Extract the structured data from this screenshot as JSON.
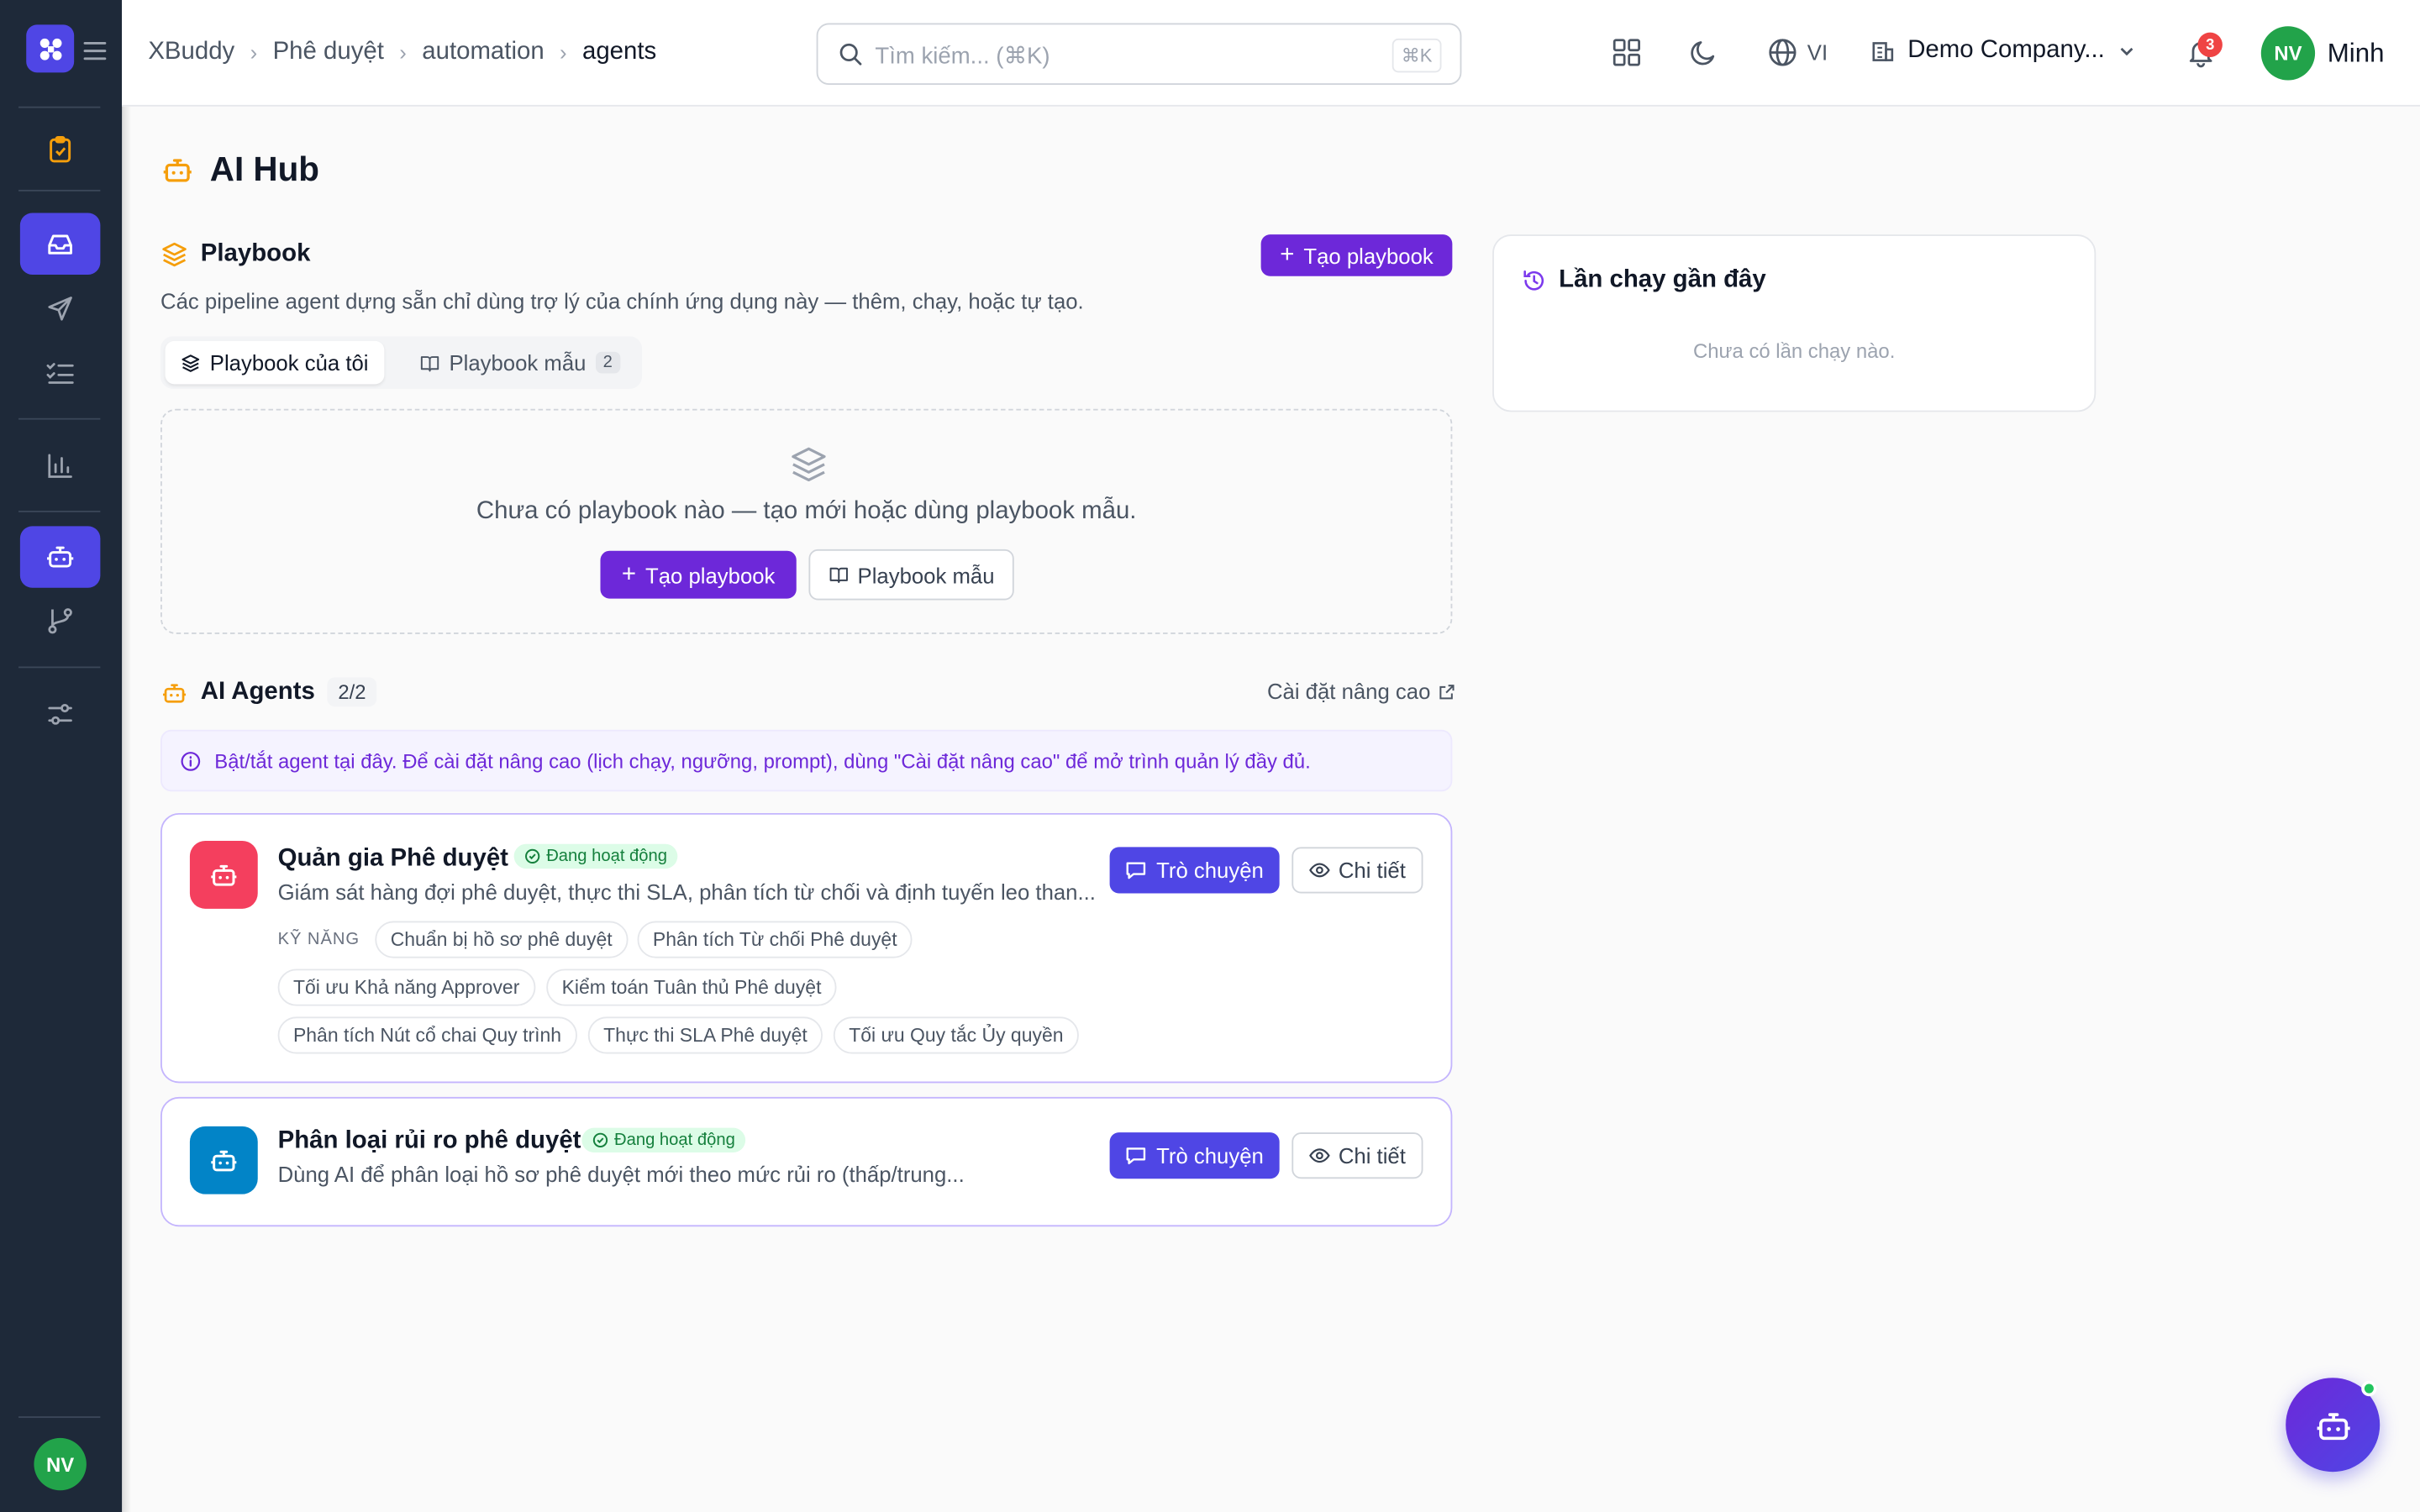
{
  "app": {
    "name": "XBuddy",
    "user_initials": "NV",
    "user_name": "Minh"
  },
  "breadcrumb": [
    "XBuddy",
    "Phê duyệt",
    "automation",
    "agents"
  ],
  "search": {
    "placeholder": "Tìm kiếm... (⌘K)",
    "shortcut": "⌘K"
  },
  "header": {
    "language": "VI",
    "company": "Demo Company...",
    "notification_count": "3"
  },
  "sidebar": {
    "icons": [
      "clipboard-check-icon",
      "inbox-icon",
      "send-icon",
      "list-checks-icon",
      "bar-chart-icon",
      "bot-icon",
      "git-branch-icon",
      "sliders-icon"
    ],
    "active": [
      "inbox-icon",
      "bot-icon"
    ]
  },
  "page": {
    "title": "AI Hub"
  },
  "playbook": {
    "title": "Playbook",
    "create_label": "Tạo playbook",
    "description": "Các pipeline agent dựng sẵn chỉ dùng trợ lý của chính ứng dụng này — thêm, chạy, hoặc tự tạo.",
    "tabs": [
      {
        "label": "Playbook của tôi",
        "active": true
      },
      {
        "label": "Playbook mẫu",
        "count": "2",
        "active": false
      }
    ],
    "empty_text": "Chưa có playbook nào — tạo mới hoặc dùng playbook mẫu.",
    "empty_create_label": "Tạo playbook",
    "empty_template_label": "Playbook mẫu"
  },
  "agents": {
    "title": "AI Agents",
    "count": "2/2",
    "advanced_link": "Cài đặt nâng cao",
    "info": "Bật/tắt agent tại đây. Để cài đặt nâng cao (lịch chạy, ngưỡng, prompt), dùng \"Cài đặt nâng cao\" để mở trình quản lý đầy đủ.",
    "skills_label": "KỸ NĂNG",
    "chat_label": "Trò chuyện",
    "detail_label": "Chi tiết",
    "items": [
      {
        "name": "Quản gia Phê duyệt",
        "status": "Đang hoạt động",
        "description": "Giám sát hàng đợi phê duyệt, thực thi SLA, phân tích từ chối và định tuyến leo than...",
        "icon_color": "#f43f5e",
        "skills": [
          "Chuẩn bị hồ sơ phê duyệt",
          "Phân tích Từ chối Phê duyệt",
          "Tối ưu Khả năng Approver",
          "Kiểm toán Tuân thủ Phê duyệt",
          "Phân tích Nút cổ chai Quy trình",
          "Thực thi SLA Phê duyệt",
          "Tối ưu Quy tắc Ủy quyền"
        ]
      },
      {
        "name": "Phân loại rủi ro phê duyệt",
        "status": "Đang hoạt động",
        "description": "Dùng AI để phân loại hồ sơ phê duyệt mới theo mức rủi ro (thấp/trung...",
        "icon_color": "#0284c7",
        "skills": []
      }
    ]
  },
  "recent_runs": {
    "title": "Lần chạy gần đây",
    "empty_text": "Chưa có lần chạy nào."
  },
  "colors": {
    "primary": "#6d28d9",
    "indigo": "#4f46e5",
    "sidebar_bg": "#1e2939",
    "success": "#15803d",
    "danger": "#ef4444"
  }
}
